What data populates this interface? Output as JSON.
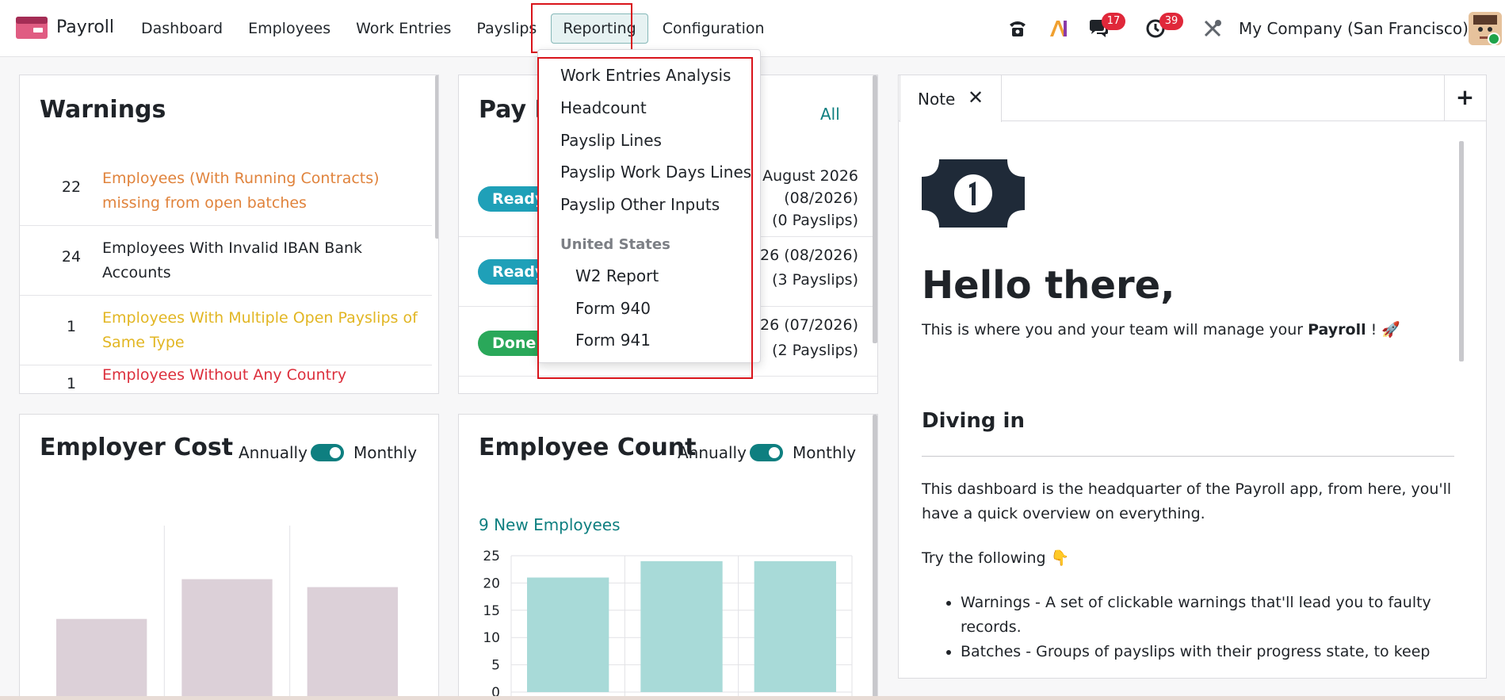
{
  "nav": {
    "app_name": "Payroll",
    "menu": [
      "Dashboard",
      "Employees",
      "Work Entries",
      "Payslips",
      "Reporting",
      "Configuration"
    ],
    "active_menu": "Reporting",
    "company": "My Company (San Francisco)",
    "messages_count": "17",
    "activities_count": "39",
    "ai_label": "AI"
  },
  "reporting_menu": {
    "items": [
      "Work Entries Analysis",
      "Headcount",
      "Payslip Lines",
      "Payslip Work Days Lines",
      "Payslip Other Inputs"
    ],
    "section_header": "United States",
    "sub_items": [
      "W2 Report",
      "Form 940",
      "Form 941"
    ]
  },
  "warnings": {
    "title": "Warnings",
    "rows": [
      {
        "count": "22",
        "text": "Employees (With Running Contracts) missing from open batches",
        "color": "#e0833c"
      },
      {
        "count": "24",
        "text": "Employees With Invalid IBAN Bank Accounts",
        "color": "#1f2328"
      },
      {
        "count": "1",
        "text": "Employees With Multiple Open Payslips of Same Type",
        "color": "#e2b623"
      },
      {
        "count": "1",
        "text": "Employees Without Any Country",
        "color": "#dc2f3c"
      }
    ]
  },
  "batches": {
    "title_visible": "Pay R",
    "all_link": "All",
    "rows": [
      {
        "state": "Ready",
        "line1": "August 2026",
        "line2": "(08/2026)",
        "line3": "(0 Payslips)"
      },
      {
        "state": "Ready",
        "line1": "26 (08/2026)",
        "line2": "(3 Payslips)"
      },
      {
        "state": "Done",
        "line1": "26 (07/2026)",
        "line2": "(2 Payslips)"
      }
    ]
  },
  "employer_cost": {
    "title": "Employer Cost",
    "toggle_left": "Annually",
    "toggle_right": "Monthly"
  },
  "employee_count": {
    "title": "Employee Count",
    "toggle_left": "Annually",
    "toggle_right": "Monthly",
    "subtitle": "9 New Employees"
  },
  "chart_data": [
    {
      "type": "bar",
      "title": "Employer Cost",
      "categories": [
        "",
        "",
        ""
      ],
      "values": [
        0.5,
        0.75,
        0.7
      ],
      "bar_color": "#dcd0d8"
    },
    {
      "type": "bar",
      "title": "Employee Count",
      "categories": [
        "",
        "",
        ""
      ],
      "values": [
        21,
        24,
        24
      ],
      "ylim": [
        0,
        25
      ],
      "yticks": [
        "0",
        "5",
        "10",
        "15",
        "20",
        "25"
      ],
      "bar_color": "#a8dad8"
    }
  ],
  "note": {
    "tab_label": "Note",
    "heading": "Hello there,",
    "intro_before": "This is where you and your team will manage your ",
    "intro_bold": "Payroll",
    "intro_after": " ! 🚀",
    "section_title": "Diving in",
    "paragraph": "This dashboard is the headquarter of the Payroll app, from here, you'll have a quick overview on everything.",
    "try_text": "Try the following 👇",
    "bullets": [
      "Warnings - A set of clickable warnings that'll lead you to faulty records.",
      "Batches - Groups of payslips with their progress state, to keep an"
    ]
  }
}
